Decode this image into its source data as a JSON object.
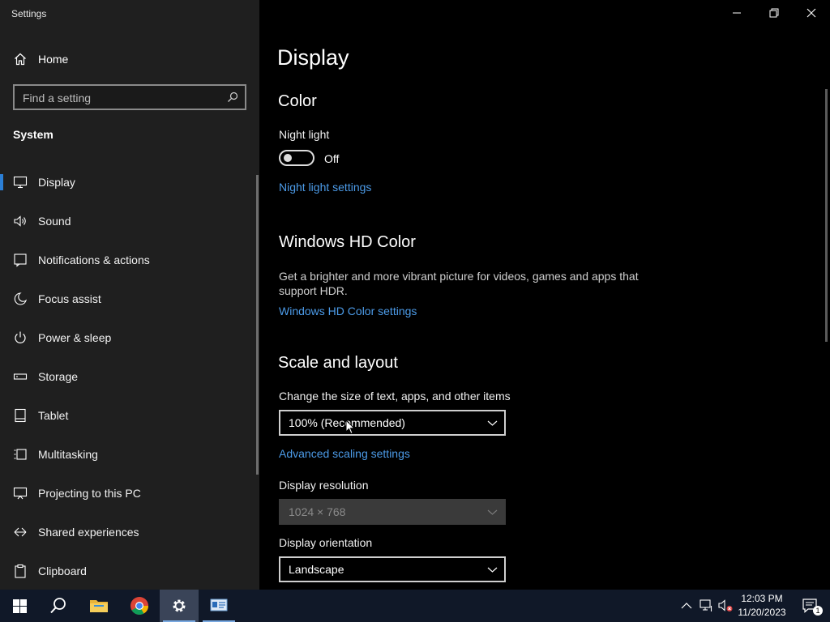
{
  "window": {
    "title": "Settings"
  },
  "sidebar": {
    "home_label": "Home",
    "search_placeholder": "Find a setting",
    "section": "System",
    "items": [
      {
        "label": "Display",
        "icon": "monitor-icon",
        "active": true
      },
      {
        "label": "Sound",
        "icon": "speaker-icon"
      },
      {
        "label": "Notifications & actions",
        "icon": "notification-icon"
      },
      {
        "label": "Focus assist",
        "icon": "moon-icon"
      },
      {
        "label": "Power & sleep",
        "icon": "power-icon"
      },
      {
        "label": "Storage",
        "icon": "storage-icon"
      },
      {
        "label": "Tablet",
        "icon": "tablet-icon"
      },
      {
        "label": "Multitasking",
        "icon": "multitasking-icon"
      },
      {
        "label": "Projecting to this PC",
        "icon": "projecting-icon"
      },
      {
        "label": "Shared experiences",
        "icon": "shared-experiences-icon"
      },
      {
        "label": "Clipboard",
        "icon": "clipboard-icon"
      }
    ]
  },
  "main": {
    "title": "Display",
    "color": {
      "heading": "Color",
      "night_light_label": "Night light",
      "night_light_state": "Off",
      "night_light_link": "Night light settings"
    },
    "hdr": {
      "heading": "Windows HD Color",
      "description": "Get a brighter and more vibrant picture for videos, games and apps that support HDR.",
      "link": "Windows HD Color settings"
    },
    "scale": {
      "heading": "Scale and layout",
      "size_label": "Change the size of text, apps, and other items",
      "size_value": "100% (Recommended)",
      "advanced_link": "Advanced scaling settings",
      "resolution_label": "Display resolution",
      "resolution_value": "1024 × 768",
      "orientation_label": "Display orientation",
      "orientation_value": "Landscape"
    }
  },
  "taskbar": {
    "time": "12:03 PM",
    "date": "11/20/2023",
    "notification_count": "1",
    "apps": [
      "start-icon",
      "search-icon",
      "file-explorer-icon",
      "chrome-icon",
      "settings-icon",
      "control-panel-icon"
    ]
  },
  "colors": {
    "accent": "#2b7fd6",
    "link": "#4c9be8",
    "sidebar_bg": "#1f1f1f",
    "taskbar_bg": "#101828"
  }
}
